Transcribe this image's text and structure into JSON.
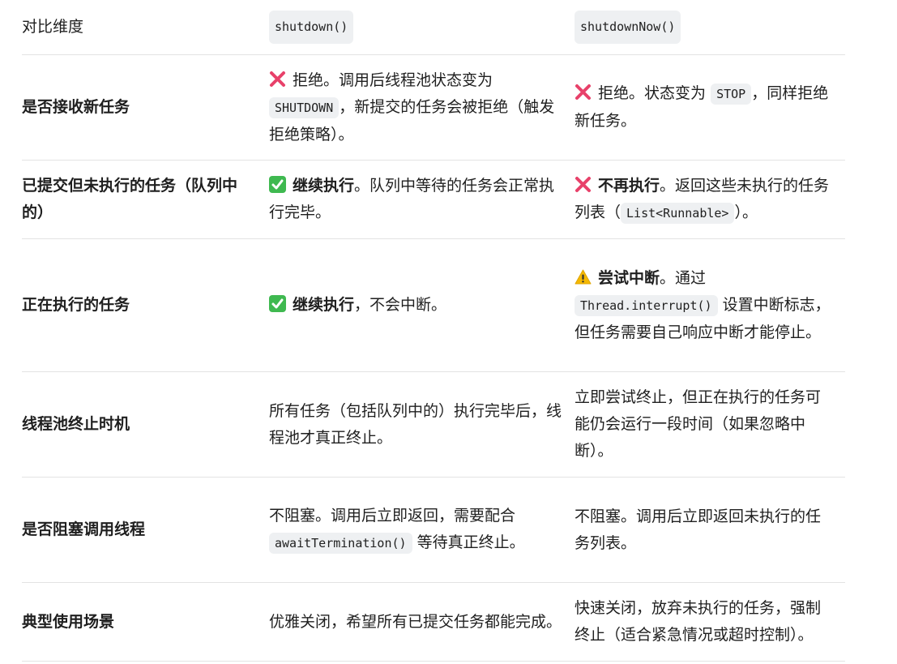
{
  "header": {
    "col1": "对比维度",
    "col2": "shutdown()",
    "col3": "shutdownNow()"
  },
  "rows": [
    {
      "label": "是否接收新任务",
      "c2": {
        "icon": "cross-mark-icon",
        "t1": "拒绝。调用后线程池状态变为",
        "code": "SHUTDOWN",
        "t2": "，新提交的任务会被拒绝（触发拒绝策略）。"
      },
      "c3": {
        "icon": "cross-mark-icon",
        "t1": "拒绝。状态变为",
        "code": "STOP",
        "t2": "，同样拒绝新任务。"
      }
    },
    {
      "label": "已提交但未执行的任务（队列中的）",
      "c2": {
        "icon": "check-mark-icon",
        "bold": "继续执行",
        "t1": "。队列中等待的任务会正常执行完毕。"
      },
      "c3": {
        "icon": "cross-mark-icon",
        "bold": "不再执行",
        "t1": "。返回这些未执行的任务列表（",
        "code": "List<Runnable>",
        "t2": "）。"
      }
    },
    {
      "label": "正在执行的任务",
      "c2": {
        "icon": "check-mark-icon",
        "bold": "继续执行",
        "t1": "，不会中断。"
      },
      "c3": {
        "icon": "warning-icon",
        "bold": "尝试中断",
        "t1": "。通过",
        "code": "Thread.interrupt()",
        "t2": "设置中断标志，但任务需要自己响应中断才能停止。"
      }
    },
    {
      "label": "线程池终止时机",
      "c2": {
        "t1": "所有任务（包括队列中的）执行完毕后，线程池才真正终止。"
      },
      "c3": {
        "t1": "立即尝试终止，但正在执行的任务可能仍会运行一段时间（如果忽略中断）。"
      }
    },
    {
      "label": "是否阻塞调用线程",
      "c2": {
        "t1": "不阻塞。调用后立即返回，需要配合",
        "code": "awaitTermination()",
        "t2": "等待真正终止。"
      },
      "c3": {
        "t1": "不阻塞。调用后立即返回未执行的任务列表。"
      }
    },
    {
      "label": "典型使用场景",
      "c2": {
        "t1": "优雅关闭，希望所有已提交任务都能完成。"
      },
      "c3": {
        "t1": "快速关闭，放弃未执行的任务，强制终止（适合紧急情况或超时控制）。"
      }
    }
  ]
}
